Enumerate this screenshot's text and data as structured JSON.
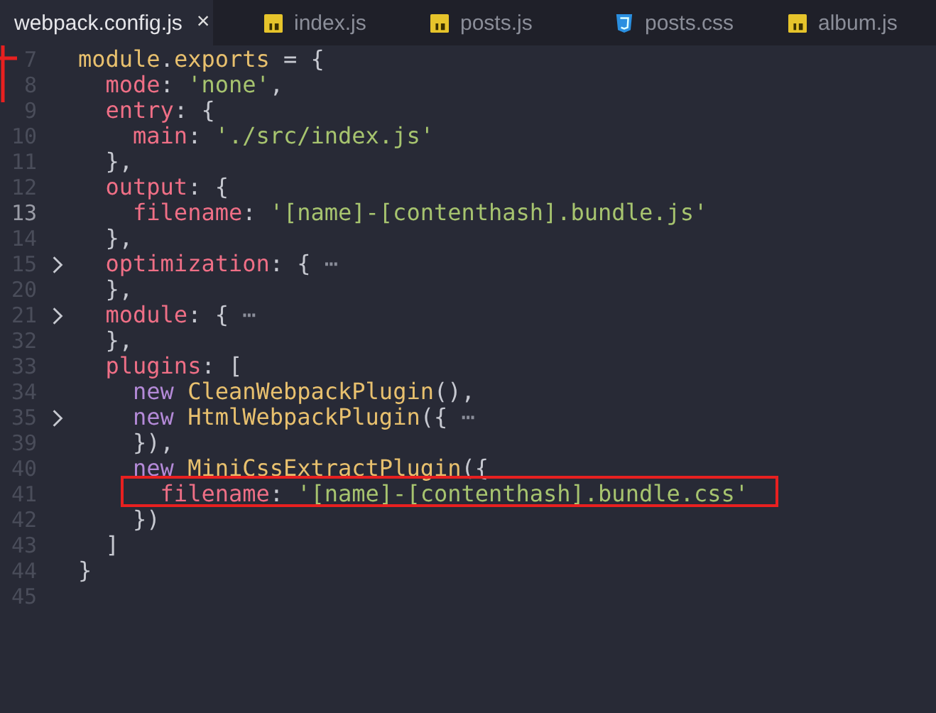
{
  "tabs": [
    {
      "label": "webpack.config.js",
      "kind": "config",
      "selected": true,
      "close": "×"
    },
    {
      "label": "index.js",
      "kind": "js",
      "selected": false
    },
    {
      "label": "posts.js",
      "kind": "js",
      "selected": false
    },
    {
      "label": "posts.css",
      "kind": "css",
      "selected": false
    },
    {
      "label": "album.js",
      "kind": "js",
      "selected": false
    }
  ],
  "editor": {
    "lines": [
      {
        "number": "7",
        "current": false,
        "folded": false,
        "tokens": [
          {
            "kind": "class",
            "text": "module"
          },
          {
            "kind": "punct",
            "text": "."
          },
          {
            "kind": "class",
            "text": "exports"
          },
          {
            "kind": "punct",
            "text": " = {"
          }
        ]
      },
      {
        "number": "8",
        "current": false,
        "folded": false,
        "tokens": [
          {
            "kind": "key",
            "text": "  mode"
          },
          {
            "kind": "punct",
            "text": ": "
          },
          {
            "kind": "string",
            "text": "'none'"
          },
          {
            "kind": "punct",
            "text": ","
          }
        ]
      },
      {
        "number": "9",
        "current": false,
        "folded": false,
        "tokens": [
          {
            "kind": "key",
            "text": "  entry"
          },
          {
            "kind": "punct",
            "text": ": {"
          }
        ]
      },
      {
        "number": "10",
        "current": false,
        "folded": false,
        "tokens": [
          {
            "kind": "key",
            "text": "    main"
          },
          {
            "kind": "punct",
            "text": ": "
          },
          {
            "kind": "string",
            "text": "'./src/index.js'"
          }
        ]
      },
      {
        "number": "11",
        "current": false,
        "folded": false,
        "tokens": [
          {
            "kind": "punct",
            "text": "  },"
          }
        ]
      },
      {
        "number": "12",
        "current": false,
        "folded": false,
        "tokens": [
          {
            "kind": "key",
            "text": "  output"
          },
          {
            "kind": "punct",
            "text": ": {"
          }
        ]
      },
      {
        "number": "13",
        "current": true,
        "folded": false,
        "tokens": [
          {
            "kind": "key",
            "text": "    filename"
          },
          {
            "kind": "punct",
            "text": ": "
          },
          {
            "kind": "string",
            "text": "'[name]-[contenthash].bundle.js'"
          }
        ]
      },
      {
        "number": "14",
        "current": false,
        "folded": false,
        "tokens": [
          {
            "kind": "punct",
            "text": "  },"
          }
        ]
      },
      {
        "number": "15",
        "current": false,
        "folded": true,
        "tokens": [
          {
            "kind": "key",
            "text": "  optimization"
          },
          {
            "kind": "punct",
            "text": ": { "
          },
          {
            "kind": "fold",
            "text": "⋯"
          }
        ]
      },
      {
        "number": "20",
        "current": false,
        "folded": false,
        "tokens": [
          {
            "kind": "punct",
            "text": "  },"
          }
        ]
      },
      {
        "number": "21",
        "current": false,
        "folded": true,
        "tokens": [
          {
            "kind": "key",
            "text": "  module"
          },
          {
            "kind": "punct",
            "text": ": { "
          },
          {
            "kind": "fold",
            "text": "⋯"
          }
        ]
      },
      {
        "number": "32",
        "current": false,
        "folded": false,
        "tokens": [
          {
            "kind": "punct",
            "text": "  },"
          }
        ]
      },
      {
        "number": "33",
        "current": false,
        "folded": false,
        "tokens": [
          {
            "kind": "key",
            "text": "  plugins"
          },
          {
            "kind": "punct",
            "text": ": ["
          }
        ]
      },
      {
        "number": "34",
        "current": false,
        "folded": false,
        "tokens": [
          {
            "kind": "keyword",
            "text": "    new"
          },
          {
            "kind": "class",
            "text": " CleanWebpackPlugin"
          },
          {
            "kind": "punct",
            "text": "(),"
          }
        ]
      },
      {
        "number": "35",
        "current": false,
        "folded": true,
        "tokens": [
          {
            "kind": "keyword",
            "text": "    new"
          },
          {
            "kind": "class",
            "text": " HtmlWebpackPlugin"
          },
          {
            "kind": "punct",
            "text": "({ "
          },
          {
            "kind": "fold",
            "text": "⋯"
          }
        ]
      },
      {
        "number": "39",
        "current": false,
        "folded": false,
        "tokens": [
          {
            "kind": "punct",
            "text": "    }),"
          }
        ]
      },
      {
        "number": "40",
        "current": false,
        "folded": false,
        "tokens": [
          {
            "kind": "keyword",
            "text": "    new"
          },
          {
            "kind": "class",
            "text": " MiniCssExtractPlugin"
          },
          {
            "kind": "punct",
            "text": "({"
          }
        ]
      },
      {
        "number": "41",
        "current": false,
        "folded": false,
        "highlighted": true,
        "tokens": [
          {
            "kind": "key",
            "text": "      filename"
          },
          {
            "kind": "punct",
            "text": ": "
          },
          {
            "kind": "string",
            "text": "'[name]-[contenthash].bundle.css'"
          }
        ]
      },
      {
        "number": "42",
        "current": false,
        "folded": false,
        "tokens": [
          {
            "kind": "punct",
            "text": "    })"
          }
        ]
      },
      {
        "number": "43",
        "current": false,
        "folded": false,
        "tokens": [
          {
            "kind": "punct",
            "text": "  ]"
          }
        ]
      },
      {
        "number": "44",
        "current": false,
        "folded": false,
        "tokens": [
          {
            "kind": "punct",
            "text": "}"
          }
        ]
      },
      {
        "number": "45",
        "current": false,
        "folded": false
      }
    ]
  }
}
